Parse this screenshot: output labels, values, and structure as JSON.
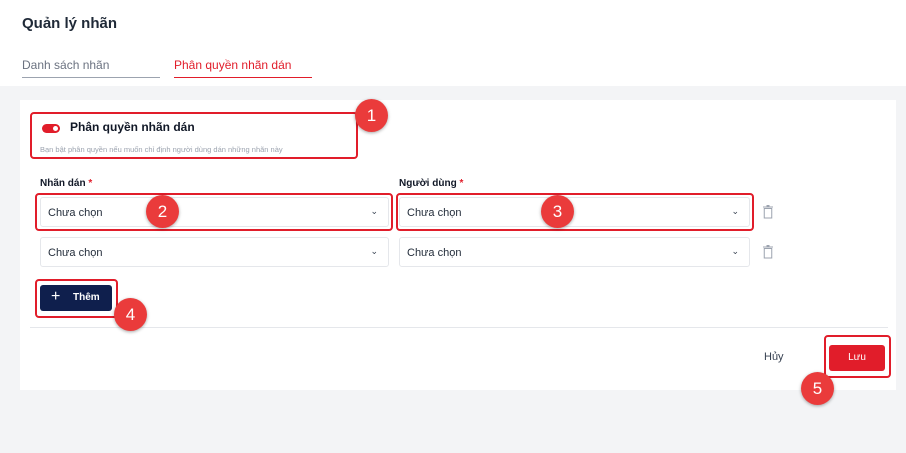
{
  "header": {
    "title": "Quản lý nhãn",
    "tabs": [
      {
        "label": "Danh sách nhãn",
        "active": false
      },
      {
        "label": "Phân quyền nhãn dán",
        "active": true
      }
    ]
  },
  "permission": {
    "title": "Phân quyền nhãn dán",
    "enabled": true,
    "description": "Bạn bật phân quyền nếu muốn chỉ định người dùng dán những nhãn này"
  },
  "form": {
    "label_label": "Nhãn dán",
    "user_label": "Người dùng",
    "required_mark": "*",
    "rows": [
      {
        "label_value": "Chưa chọn",
        "user_value": "Chưa chọn"
      },
      {
        "label_value": "Chưa chọn",
        "user_value": "Chưa chọn"
      }
    ],
    "chevron": "⌄",
    "add_label": "Thêm",
    "add_icon": "+"
  },
  "footer": {
    "cancel_label": "Hủy",
    "save_label": "Lưu"
  },
  "annotations": {
    "badges": [
      "1",
      "2",
      "3",
      "4",
      "5"
    ]
  },
  "colors": {
    "accent": "#e11d2a",
    "primary_button": "#0f1f4d",
    "badge": "#ea3b3b"
  }
}
